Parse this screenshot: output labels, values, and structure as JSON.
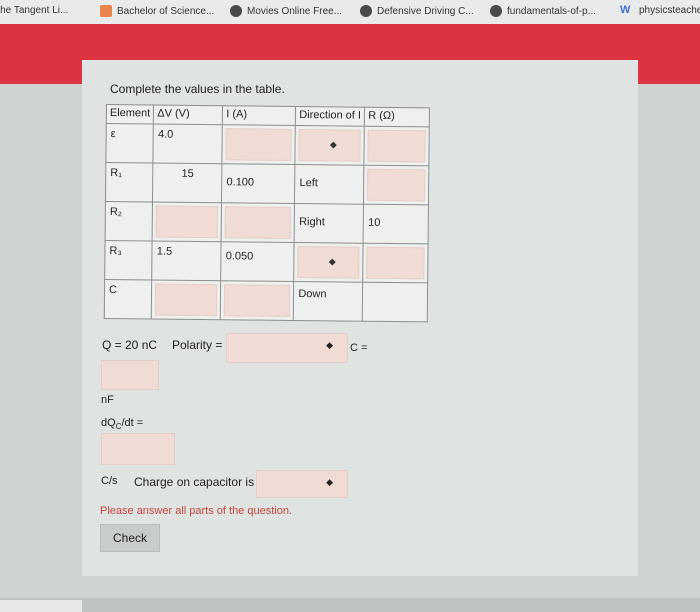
{
  "bookmarks": [
    {
      "label": "The Tangent Li..."
    },
    {
      "label": "Bachelor of Science..."
    },
    {
      "label": "Movies Online Free..."
    },
    {
      "label": "Defensive Driving C..."
    },
    {
      "label": "fundamentals-of-p..."
    },
    {
      "label": "physicsteache"
    }
  ],
  "instructions": "Complete the values in the table.",
  "table": {
    "headers": [
      "Element",
      "ΔV (V)",
      "I (A)",
      "Direction of I",
      "R (Ω)"
    ],
    "rows": [
      {
        "element": "ε",
        "dv": "4.0",
        "i": "",
        "direction": "",
        "r": ""
      },
      {
        "element": "R₁",
        "dv": "15",
        "i": "0.100",
        "direction": "Left",
        "r": ""
      },
      {
        "element": "R₂",
        "dv": "",
        "i": "",
        "direction": "Right",
        "r": "10"
      },
      {
        "element": "R₃",
        "dv": "1.5",
        "i": "0.050",
        "direction": "",
        "r": ""
      },
      {
        "element": "C",
        "dv": "",
        "i": "",
        "direction": "Down",
        "r": ""
      }
    ]
  },
  "charge": {
    "q_label": "Q = 20 nC",
    "polarity_label": "Polarity =",
    "c_label": "C =",
    "nf_unit": "nF",
    "dq_label": "dQ",
    "dq_sub": "C",
    "dq_tail": "/dt =",
    "cs_unit": "C/s",
    "charge_label": "Charge on capacitor is"
  },
  "warning": "Please answer all parts of the question.",
  "check_label": "Check",
  "colors": {
    "accent_red": "#d9343f",
    "input_fill": "#f0dcd5",
    "warning": "#c8453e"
  }
}
